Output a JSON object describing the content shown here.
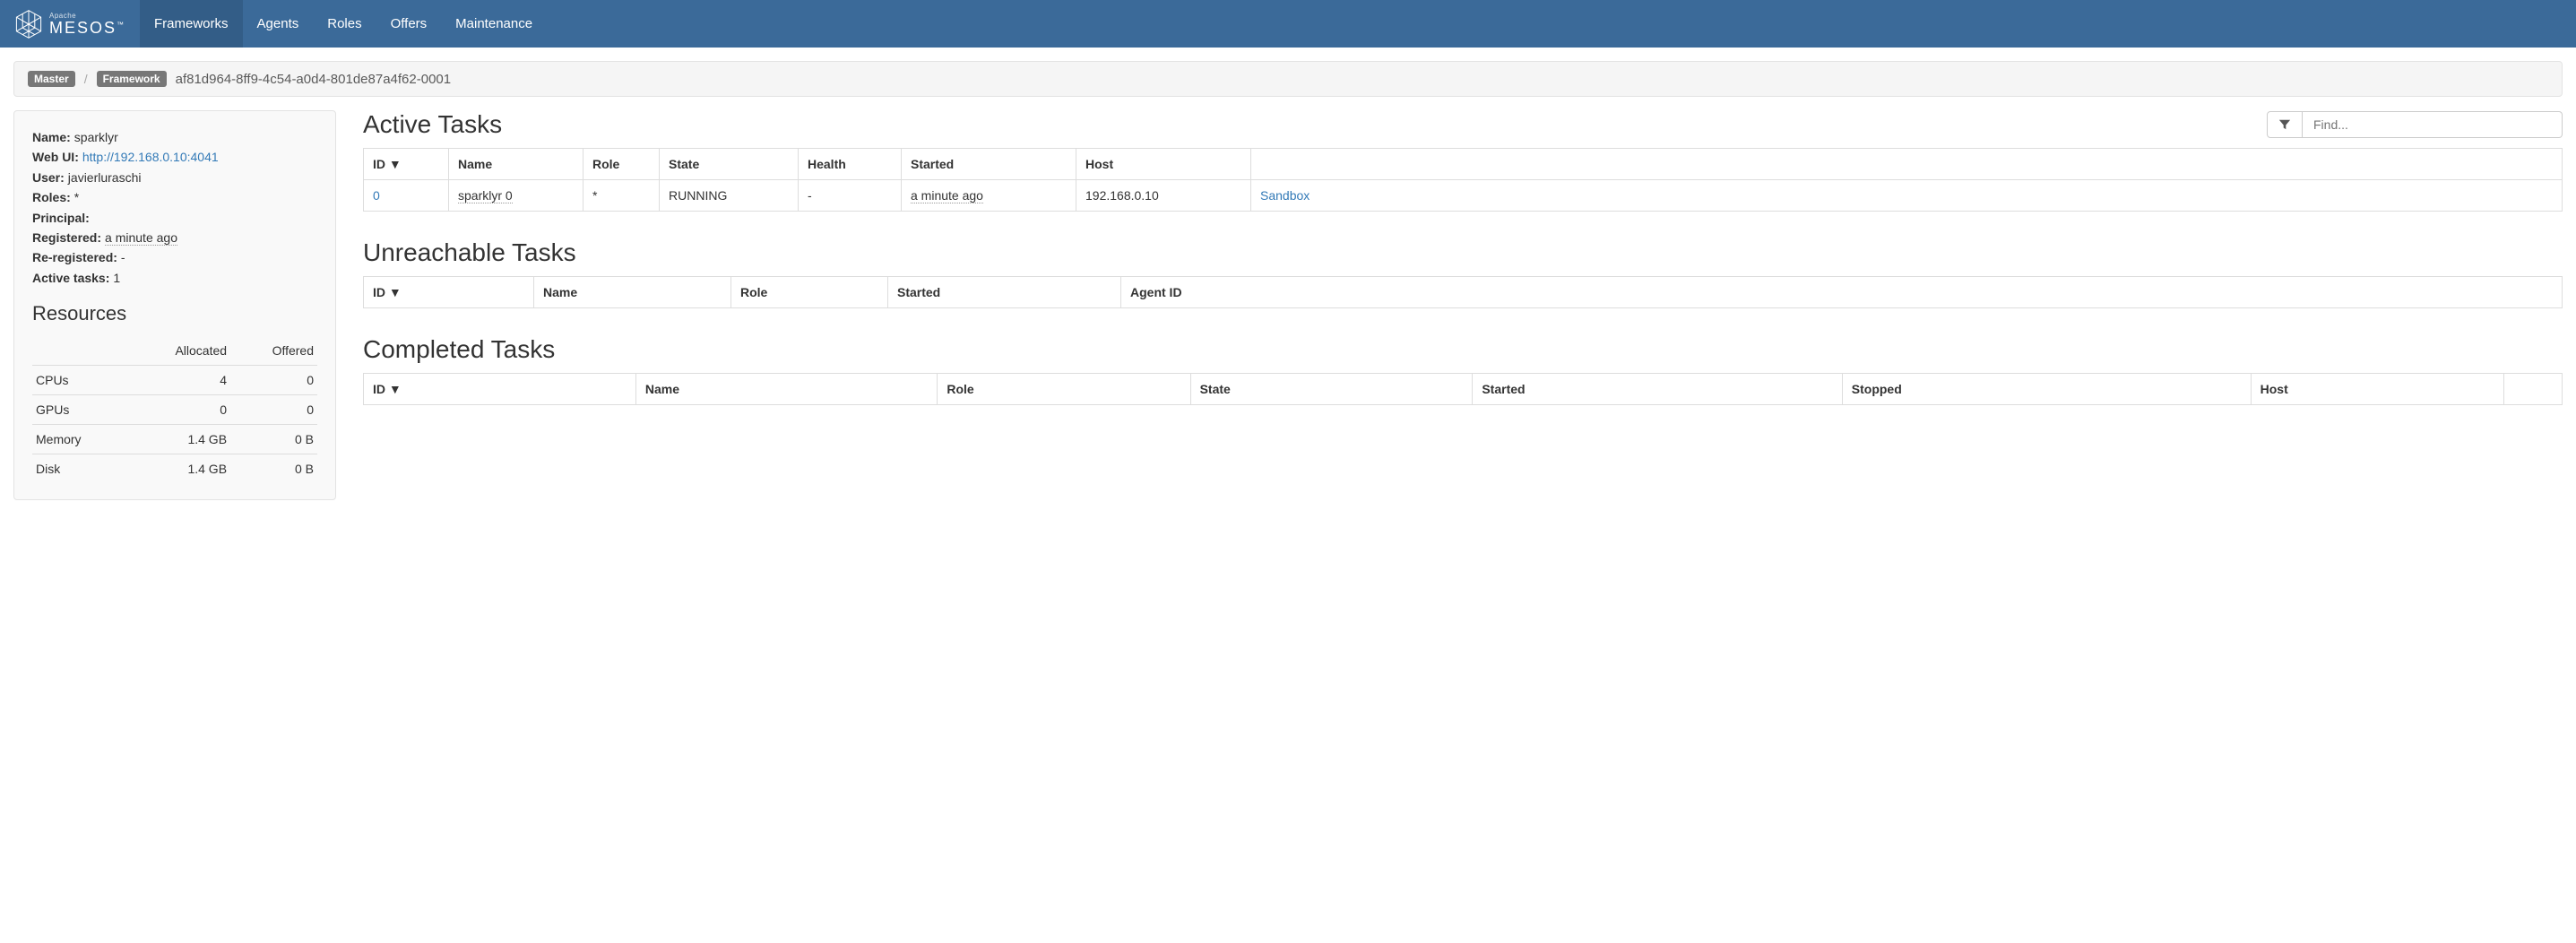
{
  "nav": {
    "frameworks": "Frameworks",
    "agents": "Agents",
    "roles": "Roles",
    "offers": "Offers",
    "maintenance": "Maintenance"
  },
  "breadcrumb": {
    "master": "Master",
    "framework": "Framework",
    "id": "af81d964-8ff9-4c54-a0d4-801de87a4f62-0001"
  },
  "framework": {
    "labels": {
      "name": "Name:",
      "web_ui": "Web UI:",
      "user": "User:",
      "roles": "Roles:",
      "principal": "Principal:",
      "registered": "Registered:",
      "re_registered": "Re-registered:",
      "active_tasks": "Active tasks:"
    },
    "name": "sparklyr",
    "web_ui": "http://192.168.0.10:4041",
    "user": "javierluraschi",
    "roles": "*",
    "principal": "",
    "registered": "a minute ago",
    "re_registered": "-",
    "active_tasks": "1"
  },
  "resources": {
    "heading": "Resources",
    "headers": {
      "allocated": "Allocated",
      "offered": "Offered"
    },
    "rows": {
      "cpus": {
        "label": "CPUs",
        "allocated": "4",
        "offered": "0"
      },
      "gpus": {
        "label": "GPUs",
        "allocated": "0",
        "offered": "0"
      },
      "memory": {
        "label": "Memory",
        "allocated": "1.4 GB",
        "offered": "0 B"
      },
      "disk": {
        "label": "Disk",
        "allocated": "1.4 GB",
        "offered": "0 B"
      }
    }
  },
  "filter": {
    "placeholder": "Find..."
  },
  "active": {
    "title": "Active Tasks",
    "headers": {
      "id": "ID ▼",
      "name": "Name",
      "role": "Role",
      "state": "State",
      "health": "Health",
      "started": "Started",
      "host": "Host",
      "sandbox": ""
    },
    "rows": [
      {
        "id": "0",
        "name": "sparklyr 0",
        "role": "*",
        "state": "RUNNING",
        "health": "-",
        "started": "a minute ago",
        "host": "192.168.0.10",
        "sandbox": "Sandbox"
      }
    ]
  },
  "unreachable": {
    "title": "Unreachable Tasks",
    "headers": {
      "id": "ID ▼",
      "name": "Name",
      "role": "Role",
      "started": "Started",
      "agent_id": "Agent ID"
    }
  },
  "completed": {
    "title": "Completed Tasks",
    "headers": {
      "id": "ID ▼",
      "name": "Name",
      "role": "Role",
      "state": "State",
      "started": "Started",
      "stopped": "Stopped",
      "host": "Host",
      "extra": ""
    }
  }
}
